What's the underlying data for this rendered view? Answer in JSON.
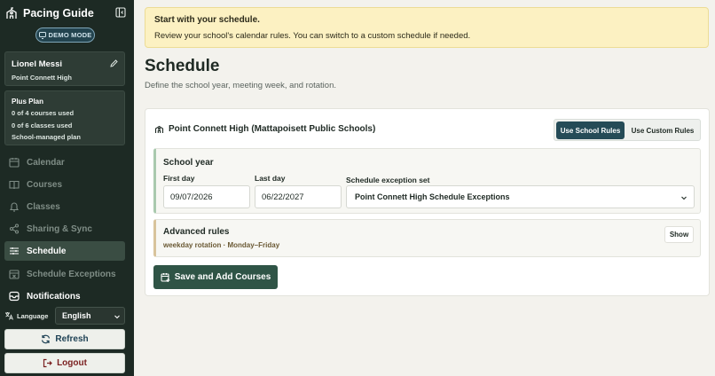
{
  "sidebar": {
    "app_title": "Pacing Guide",
    "demo_badge": "DEMO MODE",
    "user": {
      "name": "Lionel Messi",
      "school": "Point Connett High"
    },
    "plan": {
      "title": "Plus Plan",
      "courses_used": "0 of 4 courses used",
      "classes_used": "0 of 6 classes used",
      "managed": "School-managed plan"
    },
    "nav": [
      {
        "label": "Calendar",
        "icon": "calendar-icon"
      },
      {
        "label": "Courses",
        "icon": "book-icon"
      },
      {
        "label": "Classes",
        "icon": "bell-icon"
      },
      {
        "label": "Sharing & Sync",
        "icon": "share-icon"
      },
      {
        "label": "Schedule",
        "icon": "sliders-icon",
        "active": true
      },
      {
        "label": "Schedule Exceptions",
        "icon": "calendar-x-icon"
      },
      {
        "label": "Notifications",
        "icon": "inbox-icon"
      }
    ],
    "language": {
      "label": "Language",
      "selected": "English"
    },
    "refresh_label": "Refresh",
    "logout_label": "Logout"
  },
  "notice": {
    "title": "Start with your schedule.",
    "body": "Review your school's calendar rules. You can switch to a custom schedule if needed."
  },
  "main": {
    "title": "Schedule",
    "subtitle": "Define the school year, meeting week, and rotation.",
    "school_name": "Point Connett High (Mattapoisett Public Schools)",
    "mode": {
      "school_rules": "Use School Rules",
      "custom_rules": "Use Custom Rules",
      "selected": "school_rules"
    },
    "school_year": {
      "title": "School year",
      "first_day_label": "First day",
      "first_day": "09/07/2026",
      "last_day_label": "Last day",
      "last_day": "06/22/2027",
      "exception_set_label": "Schedule exception set",
      "exception_set": "Point Connett High Schedule Exceptions"
    },
    "advanced": {
      "title": "Advanced rules",
      "summary": "weekday rotation · Monday–Friday",
      "show_label": "Show"
    },
    "save_label": "Save and Add Courses"
  },
  "colors": {
    "sidebar_bg": "#1d2a24",
    "accent": "#254b57",
    "primary_button": "#2f5446",
    "notice_bg": "#fcf1c2"
  }
}
